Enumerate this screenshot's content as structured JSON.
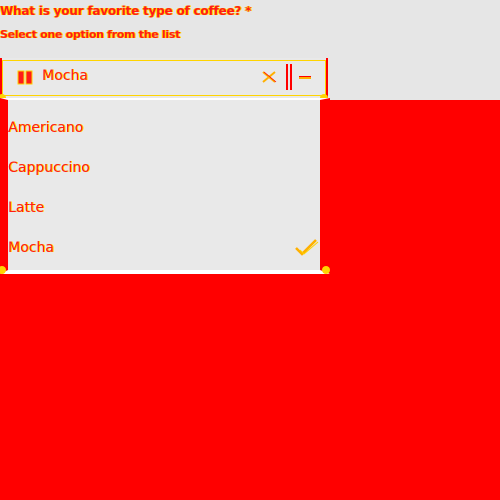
{
  "question": "What is your favorite type of coffee? *",
  "subtitle": "Select one option from the list",
  "select": {
    "value": "Mocha",
    "clear_icon": "close-icon",
    "toggle_icon": "chevron-up-icon",
    "leading_icon": "coffee-icon"
  },
  "options": [
    {
      "label": "Americano",
      "selected": false
    },
    {
      "label": "Cappuccino",
      "selected": false
    },
    {
      "label": "Latte",
      "selected": false
    },
    {
      "label": "Mocha",
      "selected": true
    }
  ],
  "colors": {
    "accent": "#ffd400",
    "background": "#ff0000",
    "panel": "#e9e9e9"
  }
}
